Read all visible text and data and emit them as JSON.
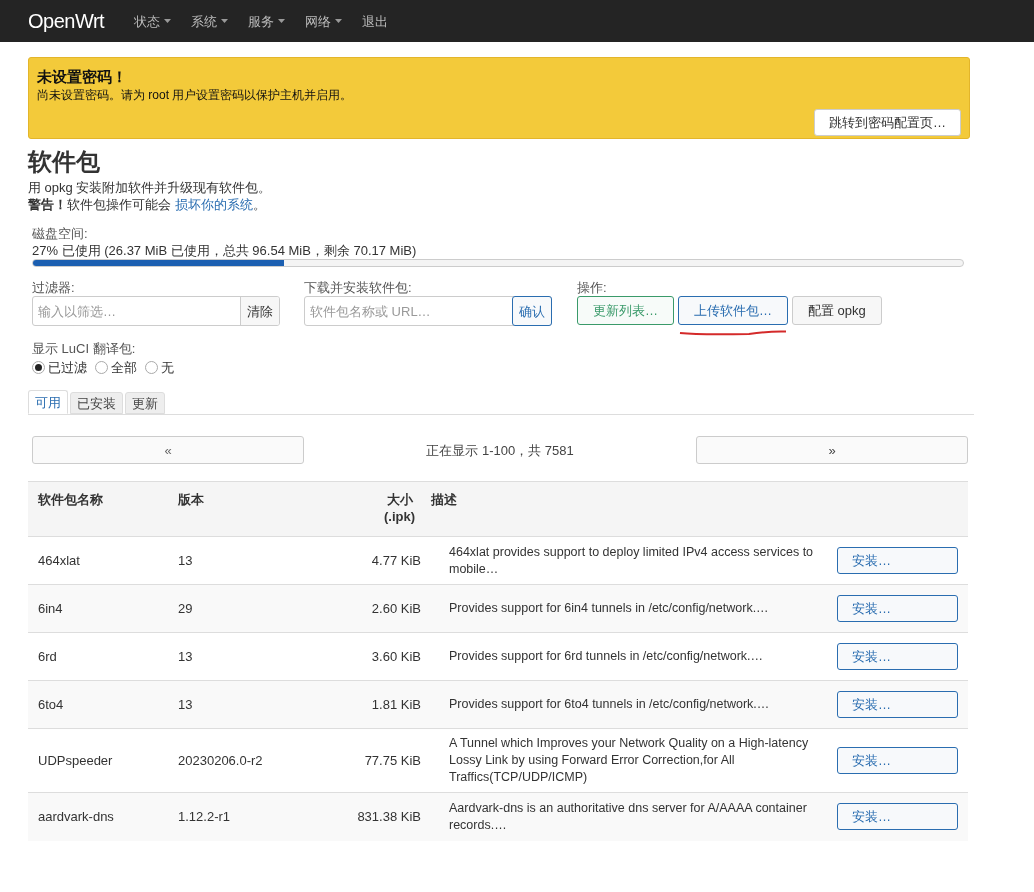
{
  "navbar": {
    "brand": "OpenWrt",
    "menus": [
      {
        "label": "状态",
        "dropdown": true
      },
      {
        "label": "系统",
        "dropdown": true
      },
      {
        "label": "服务",
        "dropdown": true
      },
      {
        "label": "网络",
        "dropdown": true
      },
      {
        "label": "退出",
        "dropdown": false
      }
    ]
  },
  "alert": {
    "title": "未设置密码！",
    "message": "尚未设置密码。请为 root 用户设置密码以保护主机并启用。",
    "button": "跳转到密码配置页…"
  },
  "page": {
    "title": "软件包",
    "description": "用 opkg 安装附加软件并升级现有软件包。",
    "warning": "**警告！**软件包操作可能会 ",
    "warning_link": "损坏你的系统",
    "warning_end": "。"
  },
  "disk": {
    "label": "磁盘空间:",
    "reading": "27% 已使用 (26.37 MiB 已使用，总共 96.54 MiB，剩余 70.17 MiB)",
    "level": 0.27
  },
  "filter": {
    "label": "过滤器:",
    "placeholder": "输入以筛选…",
    "button": "清除"
  },
  "download": {
    "label": "下载并安装软件包:",
    "placeholder": "软件包名称或 URL…",
    "button": "确认"
  },
  "actions": {
    "label": "操作:",
    "buttons": [
      {
        "label": "更新列表…",
        "kind": "positive",
        "annotated": false
      },
      {
        "label": "上传软件包…",
        "kind": "action",
        "annotated": true
      },
      {
        "label": "配置 opkg",
        "kind": "neutral",
        "annotated": false
      }
    ]
  },
  "translations": {
    "label": "显示 LuCI 翻译包:",
    "options": [
      {
        "label": "已过滤",
        "selected": true
      },
      {
        "label": "全部",
        "selected": false
      },
      {
        "label": "无",
        "selected": false
      }
    ]
  },
  "tabs": [
    {
      "label": "可用",
      "selected": true
    },
    {
      "label": "已安装",
      "selected": false
    },
    {
      "label": "更新",
      "selected": false
    }
  ],
  "pager": {
    "prev": "«",
    "info": "正在显示 1-100，共 7581",
    "next": "»"
  },
  "table": {
    "columns": [
      "软件包名称",
      "版本",
      "大小\n(.ipk)",
      "描述"
    ],
    "rows": [
      {
        "name": "464xlat",
        "version": "13",
        "size": "4.77 KiB",
        "description": "464xlat provides support to deploy limited IPv4 access services to mobile…",
        "button": "安装…"
      },
      {
        "name": "6in4",
        "version": "29",
        "size": "2.60 KiB",
        "description": "Provides support for 6in4 tunnels in /etc/config/network.…",
        "button": "安装…"
      },
      {
        "name": "6rd",
        "version": "13",
        "size": "3.60 KiB",
        "description": "Provides support for 6rd tunnels in /etc/config/network.…",
        "button": "安装…"
      },
      {
        "name": "6to4",
        "version": "13",
        "size": "1.81 KiB",
        "description": "Provides support for 6to4 tunnels in /etc/config/network.…",
        "button": "安装…"
      },
      {
        "name": "UDPspeeder",
        "version": "20230206.0-r2",
        "size": "77.75 KiB",
        "description": "A Tunnel which Improves your Network Quality on a High-latency Lossy Link by using Forward Error Correction,for All Traffics(TCP/UDP/ICMP)",
        "button": "安装…"
      },
      {
        "name": "aardvark-dns",
        "version": "1.12.2-r1",
        "size": "831.38 KiB",
        "description": "Aardvark-dns is an authoritative dns server for A/AAAA container records.…",
        "button": "安装…"
      }
    ]
  }
}
